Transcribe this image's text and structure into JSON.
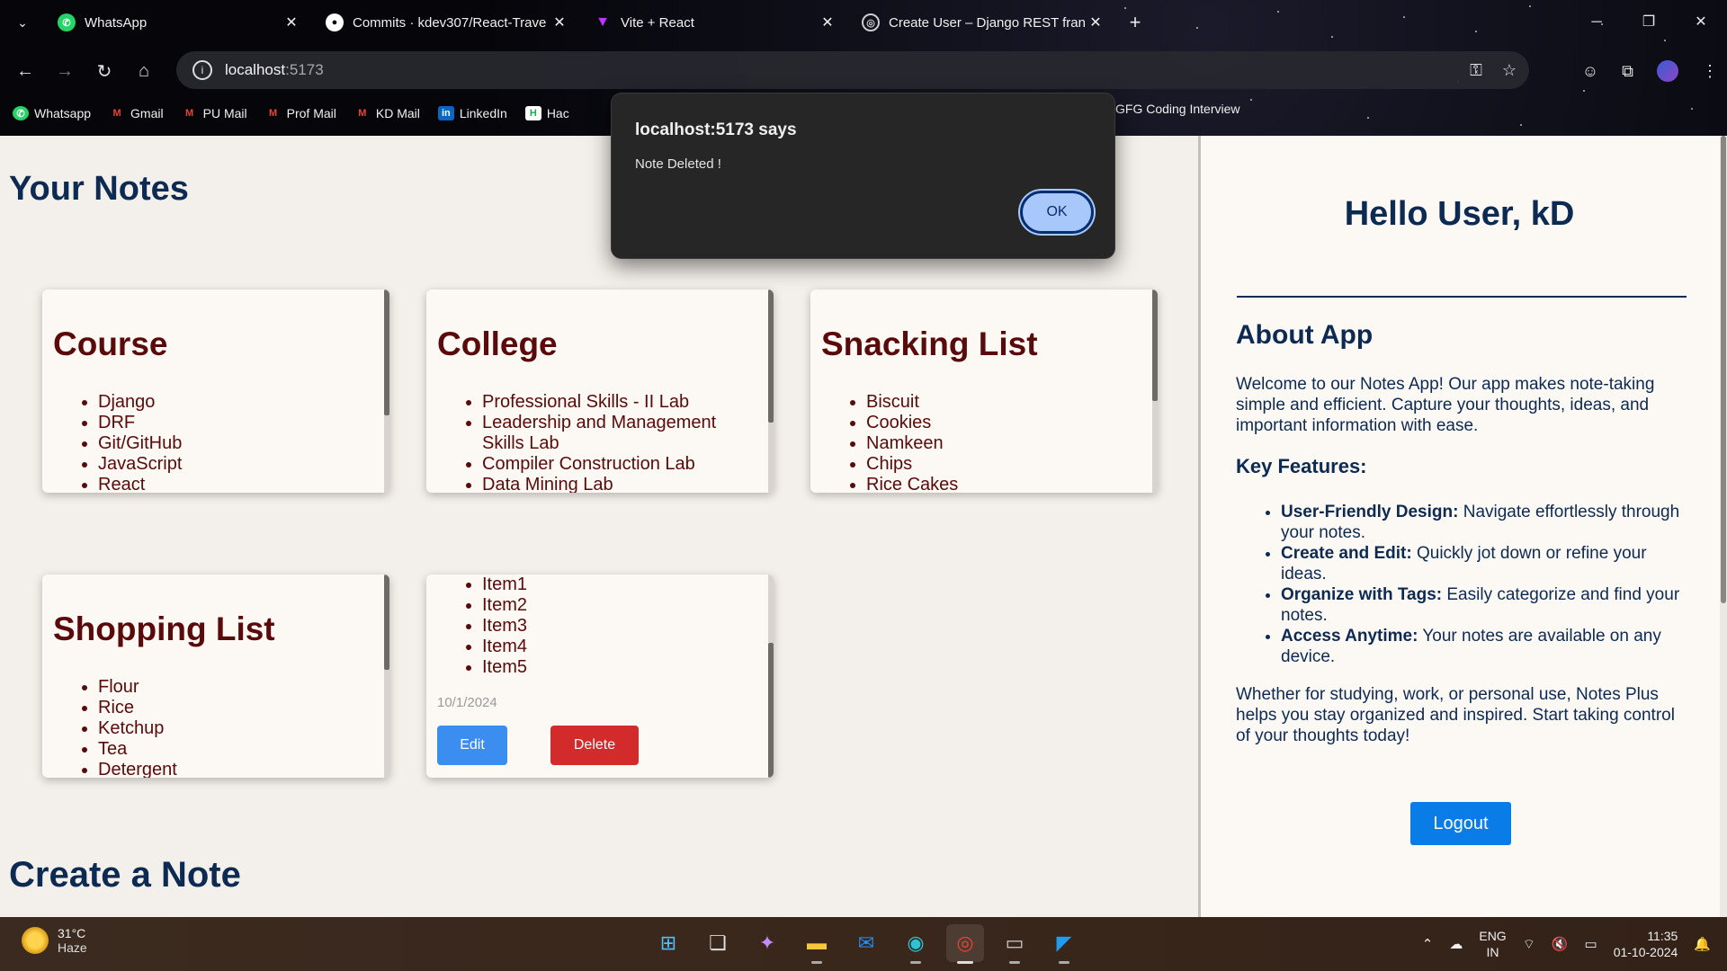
{
  "browser": {
    "tabs": [
      {
        "title": "WhatsApp",
        "icon": "whatsapp-icon"
      },
      {
        "title": "Commits · kdev307/React-Trave",
        "icon": "github-icon"
      },
      {
        "title": "Vite + React",
        "icon": "vite-icon"
      },
      {
        "title": "Create User – Django REST fran",
        "icon": "globe-icon"
      }
    ],
    "url_host": "localhost",
    "url_port": ":5173",
    "bookmarks": [
      {
        "label": "Whatsapp",
        "icon": "whatsapp-icon"
      },
      {
        "label": "Gmail",
        "icon": "gmail-icon"
      },
      {
        "label": "PU Mail",
        "icon": "gmail-icon"
      },
      {
        "label": "Prof Mail",
        "icon": "gmail-icon"
      },
      {
        "label": "KD Mail",
        "icon": "gmail-icon"
      },
      {
        "label": "LinkedIn",
        "icon": "linkedin-icon"
      },
      {
        "label": "Hac",
        "icon": "hackerrank-icon"
      }
    ],
    "bookmark_right": "GFG Coding Interview"
  },
  "alert": {
    "title": "localhost:5173 says",
    "message": "Note Deleted !",
    "ok_label": "OK"
  },
  "main": {
    "title": "Your Notes",
    "create_title": "Create a Note",
    "notes": [
      {
        "title": "Course",
        "items": [
          "Django",
          "DRF",
          "Git/GitHub",
          "JavaScript",
          "React"
        ]
      },
      {
        "title": "College",
        "items": [
          "Professional Skills - II Lab",
          "Leadership and Management Skills Lab",
          "Compiler Construction Lab",
          "Data Mining Lab"
        ]
      },
      {
        "title": "Snacking List",
        "items": [
          "Biscuit",
          "Cookies",
          "Namkeen",
          "Chips",
          "Rice Cakes"
        ]
      },
      {
        "title": "Shopping List",
        "items": [
          "Flour",
          "Rice",
          "Ketchup",
          "Tea",
          "Detergent"
        ]
      },
      {
        "title": "",
        "items": [
          "Item1",
          "Item2",
          "Item3",
          "Item4",
          "Item5"
        ],
        "date": "10/1/2024",
        "edit_label": "Edit",
        "delete_label": "Delete"
      }
    ]
  },
  "sidebar": {
    "greeting": "Hello User, kD",
    "about_title": "About App",
    "about_text": "Welcome to our Notes App! Our app makes note-taking simple and efficient. Capture your thoughts, ideas, and important information with ease.",
    "features_title": "Key Features:",
    "features": [
      {
        "name": "User-Friendly Design:",
        "text": " Navigate effortlessly through your notes."
      },
      {
        "name": "Create and Edit:",
        "text": " Quickly jot down or refine your ideas."
      },
      {
        "name": "Organize with Tags:",
        "text": " Easily categorize and find your notes."
      },
      {
        "name": "Access Anytime:",
        "text": " Your notes are available on any device."
      }
    ],
    "closing_text": "Whether for studying, work, or personal use, Notes Plus helps you stay organized and inspired. Start taking control of your thoughts today!",
    "logout_label": "Logout"
  },
  "taskbar": {
    "temp": "31°C",
    "condition": "Haze",
    "lang_top": "ENG",
    "lang_bottom": "IN",
    "time": "11:35",
    "date": "01-10-2024"
  }
}
